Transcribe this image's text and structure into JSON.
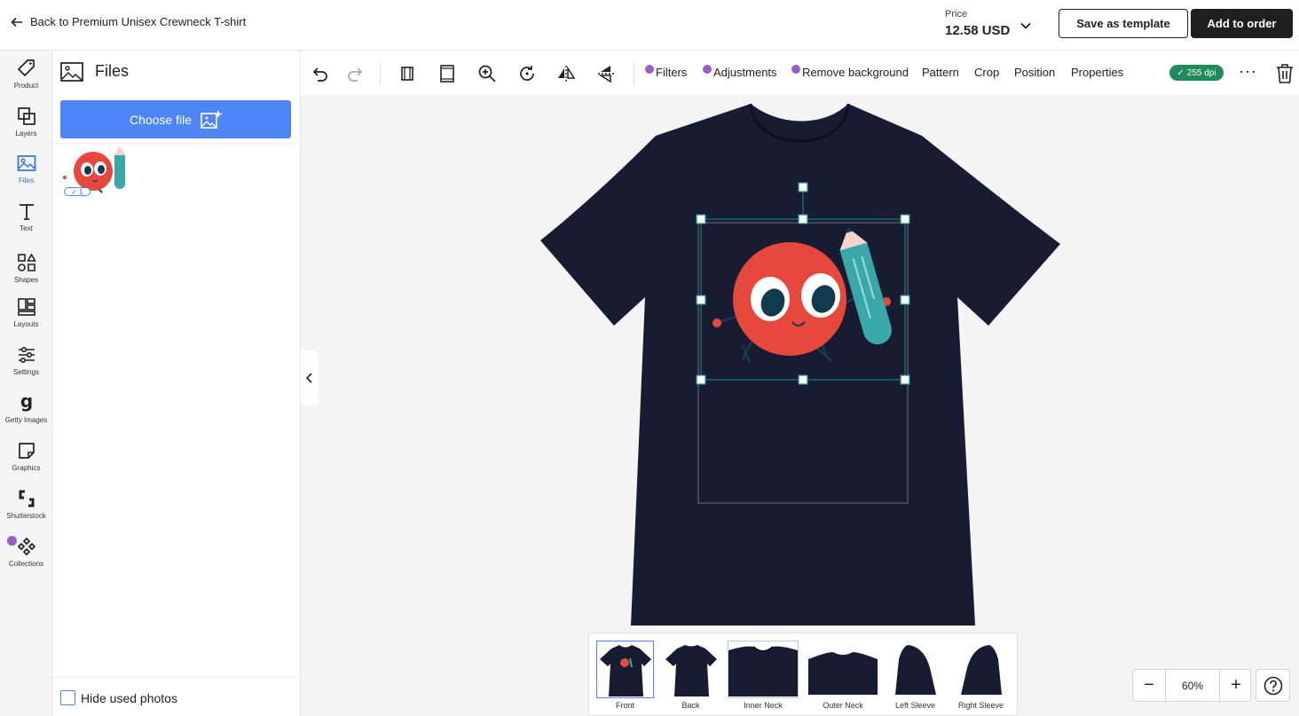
{
  "header": {
    "back_label": "Back to Premium Unisex Crewneck T-shirt",
    "price_label": "Price",
    "price_value": "12.58 USD",
    "save_template_label": "Save as template",
    "add_to_order_label": "Add to order"
  },
  "rail": {
    "items": [
      {
        "label": "Product",
        "icon": "tag-icon"
      },
      {
        "label": "Layers",
        "icon": "layers-icon"
      },
      {
        "label": "Files",
        "icon": "image-icon"
      },
      {
        "label": "Text",
        "icon": "text-icon"
      },
      {
        "label": "Shapes",
        "icon": "shapes-icon"
      },
      {
        "label": "Layouts",
        "icon": "layouts-icon"
      },
      {
        "label": "Settings",
        "icon": "sliders-icon"
      },
      {
        "label": "Getty Images",
        "icon": "getty-icon"
      },
      {
        "label": "Graphics",
        "icon": "sticker-icon"
      },
      {
        "label": "Shutterstock",
        "icon": "shutterstock-icon"
      },
      {
        "label": "Collections",
        "icon": "collections-icon"
      }
    ],
    "active": "Files"
  },
  "files_panel": {
    "title": "Files",
    "choose_file_label": "Choose file",
    "uploaded": [
      {
        "used_count": "1"
      }
    ],
    "hide_used_label": "Hide used photos"
  },
  "toolbar": {
    "icons": [
      "undo-icon",
      "redo-icon",
      "fit-width-icon",
      "fit-height-icon",
      "zoom-in-icon",
      "rotate-icon",
      "flip-horizontal-icon",
      "flip-vertical-icon"
    ],
    "menus": [
      {
        "label": "Filters",
        "premium": true
      },
      {
        "label": "Adjustments",
        "premium": true
      },
      {
        "label": "Remove background",
        "premium": true
      },
      {
        "label": "Pattern",
        "premium": false
      },
      {
        "label": "Crop",
        "premium": false
      },
      {
        "label": "Position",
        "premium": false
      },
      {
        "label": "Properties",
        "premium": false
      }
    ],
    "dpi_label": "255 dpi",
    "more_label": "···"
  },
  "views": [
    {
      "label": "Front",
      "selected": true
    },
    {
      "label": "Back",
      "selected": false
    },
    {
      "label": "Inner Neck",
      "selected": false
    },
    {
      "label": "Outer Neck",
      "selected": false
    },
    {
      "label": "Left Sleeve",
      "selected": false
    },
    {
      "label": "Right Sleeve",
      "selected": false
    }
  ],
  "zoom": {
    "value": "60%",
    "minus": "−",
    "plus": "+"
  },
  "colors": {
    "accent": "#4e86f7",
    "shirt": "#171c33",
    "selection": "#1d8a8a",
    "dpi_badge": "#1f8a5b",
    "premium_dot": "#9a5cc6"
  }
}
